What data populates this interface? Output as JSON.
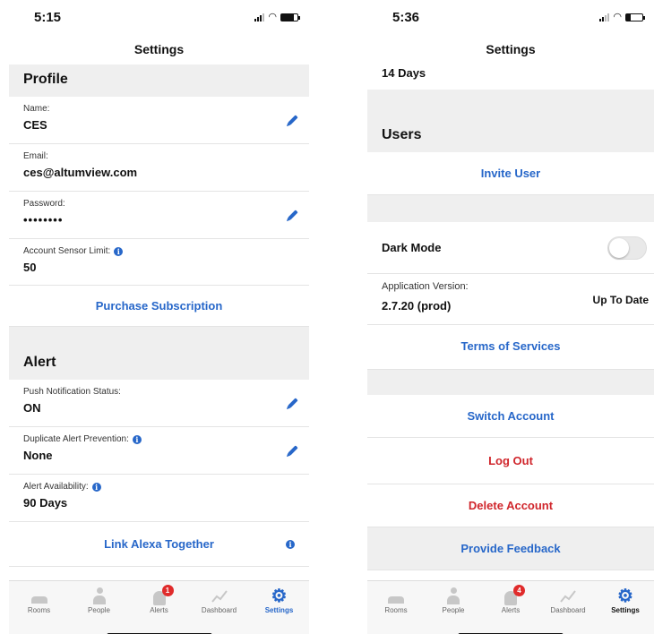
{
  "left": {
    "status": {
      "time": "5:15"
    },
    "title": "Settings",
    "profile": {
      "header": "Profile",
      "name_label": "Name:",
      "name_value": "CES",
      "email_label": "Email:",
      "email_value": "ces@altumview.com",
      "password_label": "Password:",
      "password_value": "••••••••",
      "limit_label": "Account Sensor Limit:",
      "limit_value": "50",
      "purchase": "Purchase Subscription"
    },
    "alert": {
      "header": "Alert",
      "push_label": "Push Notification Status:",
      "push_value": "ON",
      "dup_label": "Duplicate Alert Prevention:",
      "dup_value": "None",
      "avail_label": "Alert Availability:",
      "avail_value": "90 Days",
      "alexa": "Link Alexa Together"
    },
    "tabs": {
      "rooms": "Rooms",
      "people": "People",
      "alerts": "Alerts",
      "alerts_badge": "1",
      "dashboard": "Dashboard",
      "settings": "Settings"
    }
  },
  "right": {
    "status": {
      "time": "5:36"
    },
    "title": "Settings",
    "top_value": "14 Days",
    "users_header": "Users",
    "invite": "Invite User",
    "dark_mode": "Dark Mode",
    "version_label": "Application Version:",
    "version_value": "2.7.20 (prod)",
    "version_status": "Up To Date",
    "terms": "Terms of Services",
    "switch": "Switch Account",
    "logout": "Log Out",
    "delete": "Delete Account",
    "feedback": "Provide Feedback",
    "tabs": {
      "rooms": "Rooms",
      "people": "People",
      "alerts": "Alerts",
      "alerts_badge": "4",
      "dashboard": "Dashboard",
      "settings": "Settings"
    }
  },
  "colors": {
    "accent": "#2767c9",
    "danger": "#d0262c",
    "section_bg": "#efefef"
  },
  "icons": [
    "edit-pencil-icon",
    "info-icon",
    "bed-icon",
    "person-icon",
    "bell-icon",
    "chart-icon",
    "gear-icon"
  ]
}
